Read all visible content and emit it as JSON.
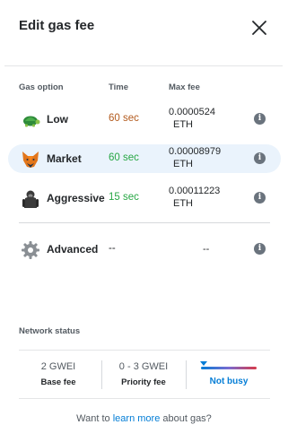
{
  "header": {
    "title": "Edit gas fee",
    "close_icon": "close-icon"
  },
  "columns": {
    "option": "Gas option",
    "time": "Time",
    "max_fee": "Max fee"
  },
  "options": [
    {
      "name": "Low",
      "icon": "turtle-icon",
      "time": "60 sec",
      "time_color": "#b35b1e",
      "fee": "0.0000524",
      "unit": "ETH",
      "selected": false
    },
    {
      "name": "Market",
      "icon": "fox-icon",
      "time": "60 sec",
      "time_color": "#28a745",
      "fee": "0.00008979",
      "unit": "ETH",
      "selected": true
    },
    {
      "name": "Aggressive",
      "icon": "gorilla-icon",
      "time": "15 sec",
      "time_color": "#28a745",
      "fee": "0.00011223",
      "unit": "ETH",
      "selected": false
    },
    {
      "name": "Advanced",
      "icon": "gear-icon",
      "time": "--",
      "time_color": "#24272a",
      "fee": "--",
      "unit": "",
      "selected": false
    }
  ],
  "network": {
    "label": "Network status",
    "base_fee": {
      "value": "2 GWEI",
      "label": "Base fee"
    },
    "priority_fee": {
      "value": "0 - 3 GWEI",
      "label": "Priority fee"
    },
    "busy": {
      "label": "Not busy",
      "level": 0.05
    }
  },
  "footer": {
    "prefix": "Want to ",
    "link": "learn more",
    "suffix": " about gas?"
  },
  "colors": {
    "accent": "#037dd6",
    "selected_row": "#eaf3fc"
  }
}
